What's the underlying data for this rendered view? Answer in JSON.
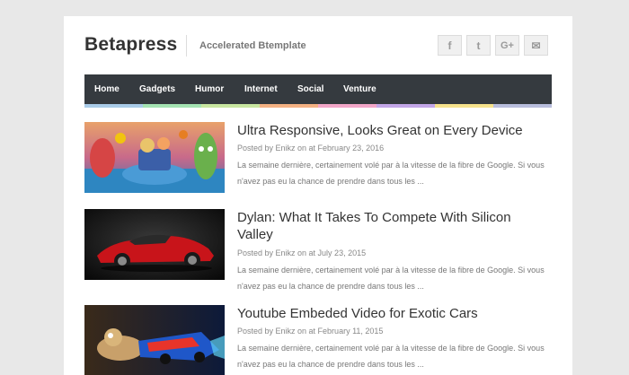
{
  "header": {
    "brand": "Betapress",
    "tagline": "Accelerated Btemplate",
    "social": [
      {
        "icon": "facebook-icon",
        "glyph": "f"
      },
      {
        "icon": "twitter-icon",
        "glyph": "t"
      },
      {
        "icon": "google-plus-icon",
        "glyph": "G+"
      },
      {
        "icon": "mail-icon",
        "glyph": "✉"
      }
    ]
  },
  "nav": {
    "items": [
      "Home",
      "Gadgets",
      "Humor",
      "Internet",
      "Social",
      "Venture"
    ],
    "stripe_colors": [
      "#a9cbe8",
      "#a4e3b2",
      "#c8e6a0",
      "#f4b183",
      "#f3a6c8",
      "#c3a6e8",
      "#f6e28c",
      "#b8bddc"
    ]
  },
  "posts": [
    {
      "title": "Ultra Responsive, Looks Great on Every Device",
      "meta": "Posted by Enikz on at February 23, 2016",
      "excerpt": "La semaine dernière, certainement volé par à la vitesse de la fibre de Google. Si vous n'avez pas eu la chance de prendre dans tous les ..."
    },
    {
      "title": "Dylan: What It Takes To Compete With Silicon Valley",
      "meta": "Posted by Enikz on at July 23, 2015",
      "excerpt": "La semaine dernière, certainement volé par à la vitesse de la fibre de Google. Si vous n'avez pas eu la chance de prendre dans tous les ..."
    },
    {
      "title": "Youtube Embeded Video for Exotic Cars",
      "meta": "Posted by Enikz on at February 11, 2015",
      "excerpt": "La semaine dernière, certainement volé par à la vitesse de la fibre de Google. Si vous n'avez pas eu la chance de prendre dans tous les ..."
    }
  ]
}
